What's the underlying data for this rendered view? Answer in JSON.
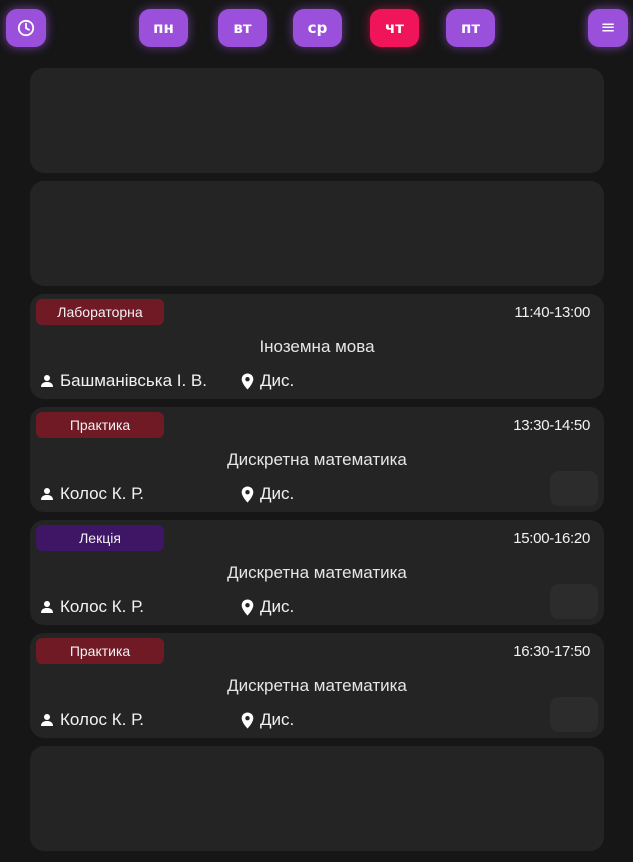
{
  "header": {
    "clock_button": {
      "icon": "clock-icon"
    },
    "menu_button": {
      "label": "≡",
      "icon": "menu-icon"
    },
    "days": [
      {
        "label": "пн",
        "active": false
      },
      {
        "label": "вт",
        "active": false
      },
      {
        "label": "ср",
        "active": false
      },
      {
        "label": "чт",
        "active": true
      },
      {
        "label": "пт",
        "active": false
      }
    ]
  },
  "colors": {
    "background": "#161616",
    "card": "#242424",
    "accent_purple": "#9b50dc",
    "active_day": "#f0145a",
    "badge_red": "#701a26",
    "badge_purple": "#3f1566"
  },
  "lessons": [
    {
      "type": "Лабораторна",
      "time": "11:40-13:00",
      "subject": "Іноземна мова",
      "teacher": "Башманівська І. В.",
      "room": "Дис."
    },
    {
      "type": "Практика",
      "time": "13:30-14:50",
      "subject": "Дискретна математика",
      "teacher": "Колос К. Р.",
      "room": "Дис."
    },
    {
      "type": "Лекція",
      "time": "15:00-16:20",
      "subject": "Дискретна математика",
      "teacher": "Колос К. Р.",
      "room": "Дис."
    },
    {
      "type": "Практика",
      "time": "16:30-17:50",
      "subject": "Дискретна математика",
      "teacher": "Колос К. Р.",
      "room": "Дис."
    }
  ]
}
